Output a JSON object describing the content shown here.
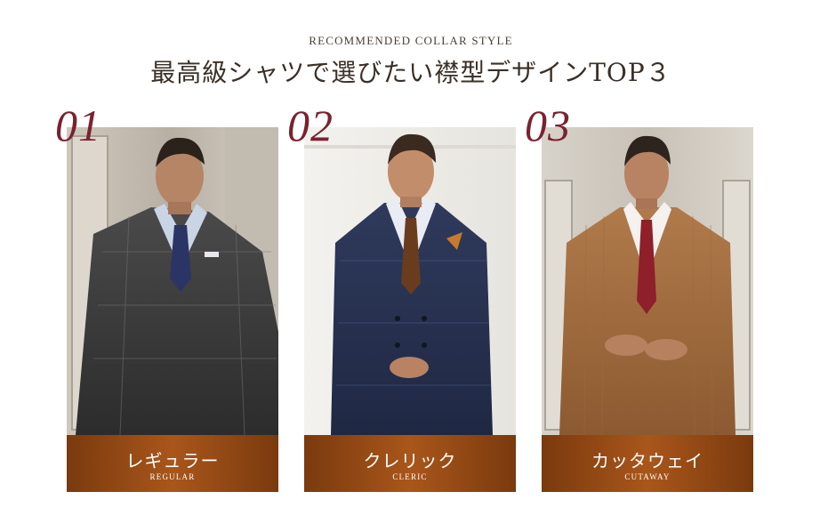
{
  "header": {
    "eyebrow": "RECOMMENDED COLLAR STYLE",
    "title": "最高級シャツで選びたい襟型デザインTOP３"
  },
  "items": [
    {
      "number": "01",
      "label_jp": "レギュラー",
      "label_en": "REGULAR"
    },
    {
      "number": "02",
      "label_jp": "クレリック",
      "label_en": "CLERIC"
    },
    {
      "number": "03",
      "label_jp": "カッタウェイ",
      "label_en": "CUTAWAY"
    }
  ],
  "colors": {
    "number_accent": "#7a2230",
    "band_brown": "#9a4f18",
    "title_text": "#3a3027"
  }
}
